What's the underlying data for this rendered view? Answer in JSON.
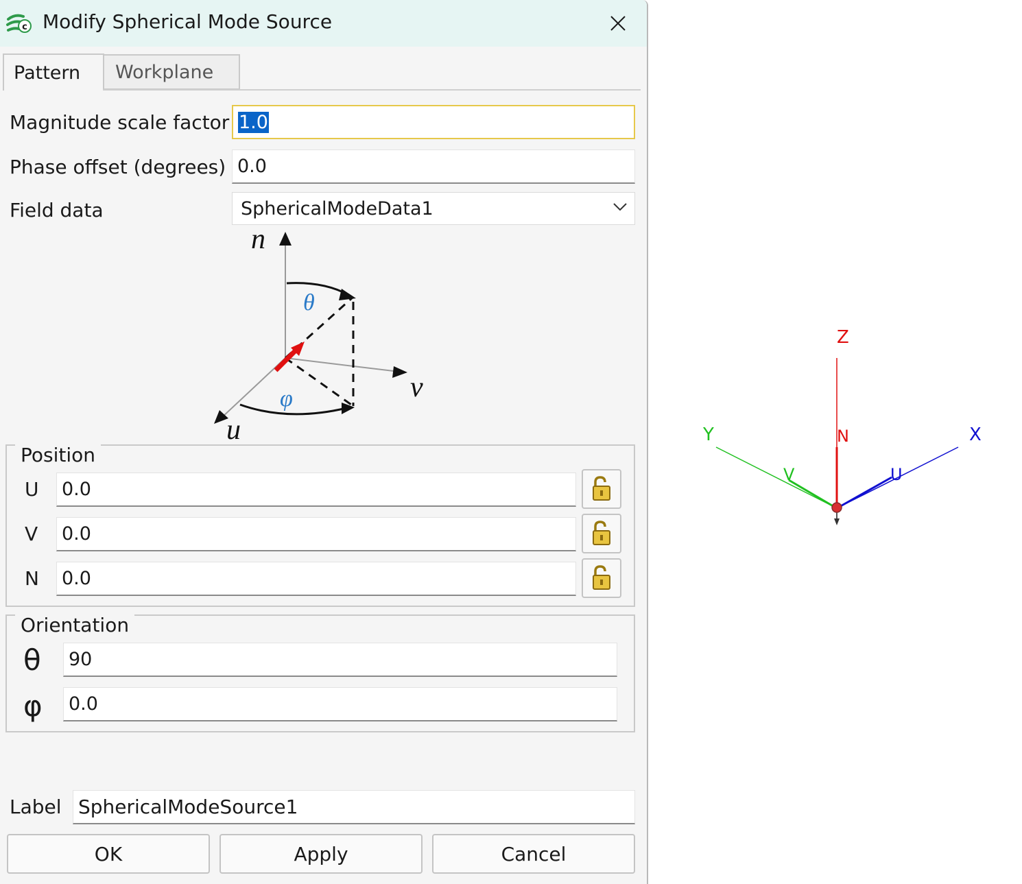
{
  "window": {
    "title": "Modify Spherical Mode Source"
  },
  "tabs": [
    {
      "label": "Pattern"
    },
    {
      "label": "Workplane"
    }
  ],
  "pattern": {
    "magnitude_label": "Magnitude scale factor",
    "magnitude_value": "1.0",
    "phase_label": "Phase offset (degrees)",
    "phase_value": "0.0",
    "field_data_label": "Field data",
    "field_data_value": "SphericalModeData1"
  },
  "diagram": {
    "n": "n",
    "v": "v",
    "u": "u",
    "theta": "θ",
    "phi": "φ"
  },
  "position": {
    "title": "Position",
    "rows": [
      {
        "label": "U",
        "value": "0.0"
      },
      {
        "label": "V",
        "value": "0.0"
      },
      {
        "label": "N",
        "value": "0.0"
      }
    ]
  },
  "orientation": {
    "title": "Orientation",
    "rows": [
      {
        "label": "θ",
        "value": "90"
      },
      {
        "label": "φ",
        "value": "0.0"
      }
    ]
  },
  "label_field": {
    "label": "Label",
    "value": "SphericalModeSource1"
  },
  "buttons": {
    "ok": "OK",
    "apply": "Apply",
    "cancel": "Cancel"
  },
  "viewer": {
    "axes": {
      "z": "Z",
      "n": "N",
      "y": "Y",
      "v": "V",
      "x": "X",
      "u": "U"
    },
    "colors": {
      "z": "#e01010",
      "y": "#20c020",
      "x": "#1010d0"
    }
  }
}
